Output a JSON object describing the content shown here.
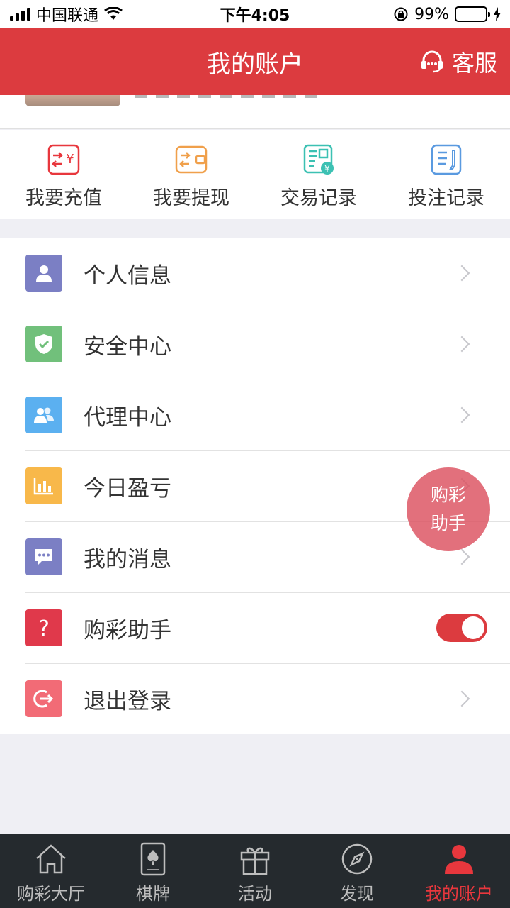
{
  "status_bar": {
    "carrier": "中国联通",
    "time": "下午4:05",
    "battery": "99%",
    "battery_level": 0.99
  },
  "header": {
    "title": "我的账户",
    "service_label": "客服"
  },
  "quick_actions": [
    {
      "label": "我要充值",
      "icon": "recharge-icon",
      "color": "#e8373d"
    },
    {
      "label": "我要提现",
      "icon": "withdraw-icon",
      "color": "#f0a04b"
    },
    {
      "label": "交易记录",
      "icon": "transaction-record-icon",
      "color": "#3cc1b3"
    },
    {
      "label": "投注记录",
      "icon": "bet-record-icon",
      "color": "#5a9ae0"
    }
  ],
  "menu": [
    {
      "label": "个人信息",
      "icon": "user-icon",
      "color": "#7b7fc4"
    },
    {
      "label": "安全中心",
      "icon": "shield-icon",
      "color": "#71c07b"
    },
    {
      "label": "代理中心",
      "icon": "group-icon",
      "color": "#5bb0f0"
    },
    {
      "label": "今日盈亏",
      "icon": "bar-chart-icon",
      "color": "#f8b84a"
    },
    {
      "label": "我的消息",
      "icon": "message-icon",
      "color": "#7b7fc4"
    },
    {
      "label": "购彩助手",
      "icon": "question-icon",
      "color": "#e0394b",
      "toggle": true
    },
    {
      "label": "退出登录",
      "icon": "logout-icon",
      "color": "#f26b76"
    }
  ],
  "floating_helper": {
    "line1": "购彩",
    "line2": "助手"
  },
  "tab_bar": [
    {
      "label": "购彩大厅",
      "icon": "home-icon"
    },
    {
      "label": "棋牌",
      "icon": "card-icon"
    },
    {
      "label": "活动",
      "icon": "gift-icon"
    },
    {
      "label": "发现",
      "icon": "compass-icon"
    },
    {
      "label": "我的账户",
      "icon": "account-icon",
      "active": true
    }
  ]
}
